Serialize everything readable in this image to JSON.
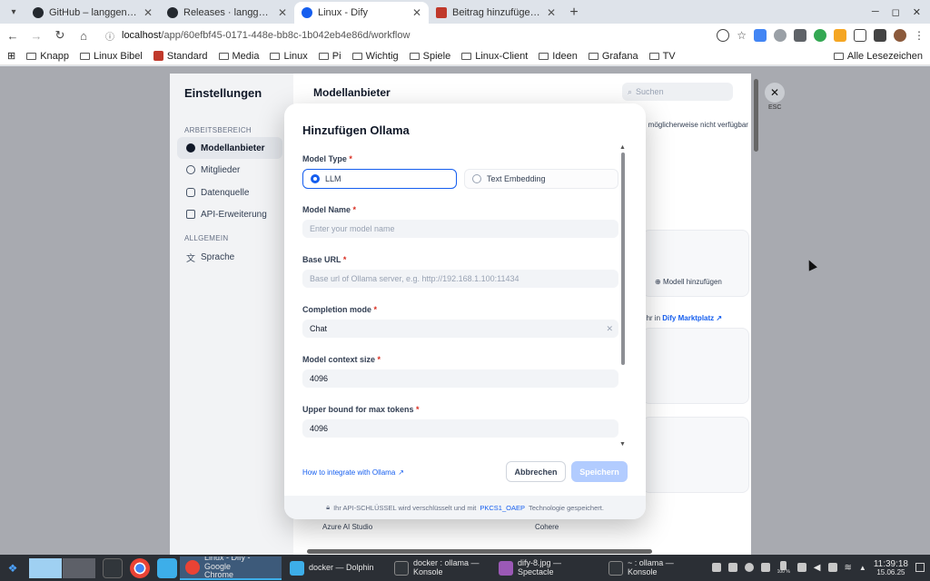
{
  "browser": {
    "tabs": [
      {
        "title": "GitHub – langgenius/dify: F",
        "color": "#24292f",
        "active": false
      },
      {
        "title": "Releases · langgenius/dify",
        "color": "#24292f",
        "active": false
      },
      {
        "title": "Linux - Dify",
        "color": "#155eef",
        "active": true
      },
      {
        "title": "Beitrag hinzufügen ‹ Linux",
        "color": "#c0392b",
        "active": false
      }
    ],
    "url_host": "localhost",
    "url_path": "/app/60efbf45-0171-448e-bb8c-1b042eb4e86d/workflow",
    "bookmarks": [
      "Knapp",
      "Linux Bibel",
      "Standard",
      "Media",
      "Linux",
      "Pi",
      "Wichtig",
      "Spiele",
      "Linux-Client",
      "Ideen",
      "Grafana",
      "TV"
    ],
    "bookmarks_all": "Alle Lesezeichen"
  },
  "settings": {
    "title": "Einstellungen",
    "section_workspace": "ARBEITSBEREICH",
    "items": [
      "Modellanbieter",
      "Mitglieder",
      "Datenquelle",
      "API-Erweiterung"
    ],
    "section_general": "ALLGEMEIN",
    "language": "Sprache",
    "main_title": "Modellanbieter",
    "search_placeholder": "Suchen",
    "note": "d möglicherweise nicht verfügbar",
    "add_model": "Modell hinzufügen",
    "more_text": "ehr in",
    "marketplace": "Dify Marktplatz ↗",
    "provider_azure": "Azure AI Studio",
    "provider_cohere": "Cohere",
    "esc": "ESC"
  },
  "modal": {
    "title": "Hinzufügen Ollama",
    "model_type_label": "Model Type",
    "model_type_options": [
      "LLM",
      "Text Embedding"
    ],
    "model_name_label": "Model Name",
    "model_name_placeholder": "Enter your model name",
    "base_url_label": "Base URL",
    "base_url_placeholder": "Base url of Ollama server, e.g. http://192.168.1.100:11434",
    "completion_mode_label": "Completion mode",
    "completion_mode_value": "Chat",
    "context_size_label": "Model context size",
    "context_size_value": "4096",
    "max_tokens_label": "Upper bound for max tokens",
    "max_tokens_value": "4096",
    "integrate_link": "How to integrate with Ollama",
    "cancel": "Abbrechen",
    "save": "Speichern",
    "footer_pre": "Ihr API-SCHLÜSSEL wird verschlüsselt und mit",
    "footer_key": "PKCS1_OAEP",
    "footer_post": "Technologie gespeichert."
  },
  "taskbar": {
    "tasks": [
      {
        "line1": "Linux - Dify - Google",
        "line2": "Chrome",
        "active": true
      },
      {
        "line1": "docker — Dolphin",
        "line2": "",
        "active": false
      },
      {
        "line1": "docker : ollama —",
        "line2": "Konsole",
        "active": false
      },
      {
        "line1": "dify-8.jpg — Spectacle",
        "line2": "",
        "active": false
      },
      {
        "line1": "~ : ollama — Konsole",
        "line2": "",
        "active": false
      }
    ],
    "battery": "100 %",
    "time": "11:39:18",
    "date": "15.06.25"
  }
}
